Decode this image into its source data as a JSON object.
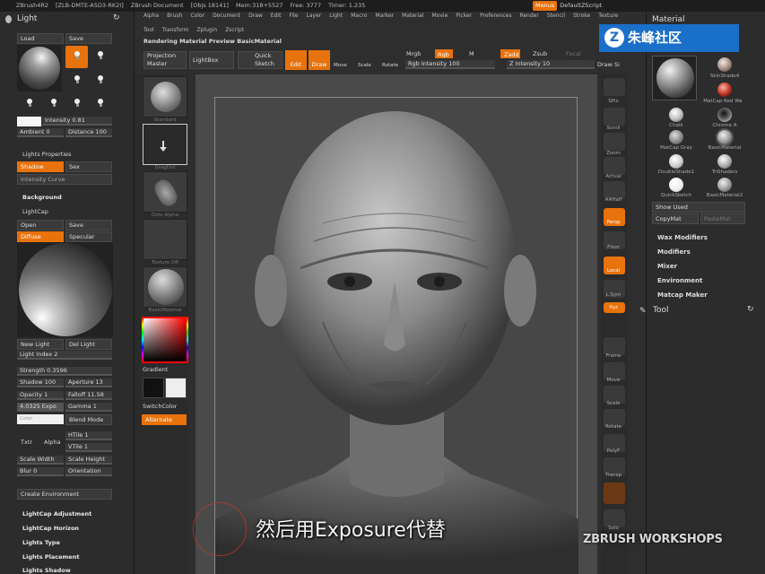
{
  "title_bar": {
    "items": [
      "ZBrush4R2",
      "[ZLB-DMTE-A5D3-RK2I]",
      "ZBrush Document",
      "[Objs 18141]",
      "Mem:318+5527",
      "Free: 3777",
      "Timer: 1.235"
    ],
    "menus_btn": "Menus",
    "default_script": "DefaultZScript"
  },
  "menubar": [
    "Alpha",
    "Brush",
    "Color",
    "Document",
    "Draw",
    "Edit",
    "File",
    "Layer",
    "Light",
    "Macro",
    "Marker",
    "Material",
    "Movie",
    "Picker",
    "Preferences",
    "Render",
    "Stencil",
    "Stroke",
    "Texture",
    "Tool",
    "Transform",
    "Zplugin",
    "Zscript"
  ],
  "toolbar": {
    "rendering_label": "Rendering Material Preview BasicMaterial",
    "projection_master": "Projection Master",
    "lightbox": "LightBox",
    "quick_sketch": "Quick Sketch",
    "edit": "Edit",
    "draw": "Draw",
    "move": "Move",
    "scale": "Scale",
    "rotate": "Rotate",
    "mrgb": "Mrgb",
    "rgb": "Rgb",
    "m": "M",
    "rgb_intensity": "Rgb Intensity 100",
    "zadd": "Zadd",
    "zsub": "Zsub",
    "z_intensity": "Z Intensity 10",
    "focal": "Focal",
    "draw_size": "Draw Si"
  },
  "left_panel": {
    "title": "Light",
    "load": "Load",
    "save": "Save",
    "intensity": "Intensity 0.81",
    "ambient": "Ambient 0",
    "distance": "Distance 100",
    "lights_properties": "Lights Properties",
    "shadow": "Shadow",
    "sex": "Sex",
    "intensity_curve": "Intensity Curve",
    "background": "Background",
    "lightcap": "LightCap",
    "open": "Open",
    "save2": "Save",
    "diffuse": "Diffuse",
    "specular": "Specular",
    "new_light": "New Light",
    "del_light": "Del Light",
    "light_index": "Light Index 2",
    "strength": "Strength 0.3596",
    "shadow_val": "Shadow 100",
    "aperture": "Aperture 13",
    "opacity": "Opacity 1",
    "falloff": "Falloff 11.58",
    "exposure": "4.0325 Expo",
    "gamma": "Gamma 1",
    "color": "Color",
    "blend_mode": "Blend Mode",
    "txtr": "Txtr",
    "alpha": "Alpha",
    "htile": "HTile 1",
    "vtile": "VTile 1",
    "scale_width": "Scale Width",
    "scale_height": "Scale Height",
    "blur": "Blur 0",
    "orientation": "Orientation",
    "create_environment": "Create Environment",
    "lightcap_adjustment": "LightCap Adjustment",
    "lightcap_horizon": "LightCap Horizon",
    "lights_type": "Lights Type",
    "lights_placement": "Lights Placement",
    "lights_shadow": "Lights Shadow"
  },
  "tool_shelf": {
    "gradient": "Gradient",
    "switch_color": "SwitchColor",
    "alternate": "Alternate",
    "thumb_labels": [
      "Standard",
      "DragDot",
      "Dots Alpha",
      "Texture Off",
      "BasicMaterial"
    ]
  },
  "right_shelf": [
    "SPix",
    "Scroll",
    "Zoom",
    "Actual",
    "AAHalf",
    "Persp",
    "Floor",
    "Local",
    "L.Sym",
    "Xyz",
    "Frame",
    "Move",
    "Scale",
    "Rotate",
    "PolyF",
    "Transp",
    "Ghost",
    "Solo"
  ],
  "right_panel": {
    "title": "Material",
    "materials": [
      "SkinShade4",
      "MatCap Red Wa",
      "Chalk",
      "Chrome A",
      "MatCap Gray",
      "BasicMaterial",
      "DoubleShade1",
      "TriShaders",
      "QuickSketch",
      "BasicMaterial2"
    ],
    "show_used": "Show Used",
    "copy_mat": "CopyMat",
    "paste_mat": "PasteMat",
    "wax_modifiers": "Wax Modifiers",
    "modifiers": "Modifiers",
    "mixer": "Mixer",
    "environment": "Environment",
    "matcap_maker": "Matcap Maker",
    "tool": "Tool"
  },
  "overlay": {
    "watermark": "朱峰社区",
    "subtitle": "然后用Exposure代替",
    "brand": "ZBRUSH WORKSHOPS"
  },
  "colors": {
    "accent": "#e8720c",
    "panel": "#2c2c2c",
    "canvas": "#474747",
    "watermark": "#1a6fc9"
  }
}
